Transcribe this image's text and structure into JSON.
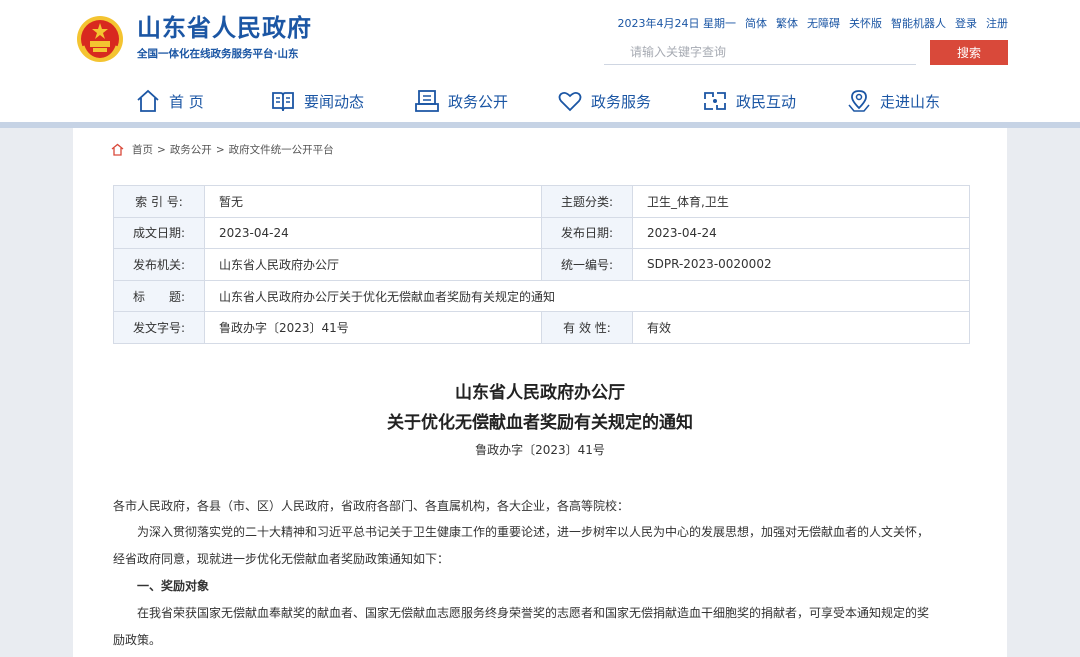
{
  "header": {
    "site_name": "山东省人民政府",
    "site_sub": "全国一体化在线政务服务平台·山东",
    "date": "2023年4月24日 星期一",
    "links": [
      "简体",
      "繁体",
      "无障碍",
      "关怀版",
      "智能机器人",
      "登录",
      "注册"
    ],
    "search_placeholder": "请输入关键字查询",
    "search_button": "搜索"
  },
  "nav": [
    {
      "label": "首 页",
      "icon": "home-icon"
    },
    {
      "label": "要闻动态",
      "icon": "news-book-icon"
    },
    {
      "label": "政务公开",
      "icon": "document-icon"
    },
    {
      "label": "政务服务",
      "icon": "heart-icon"
    },
    {
      "label": "政民互动",
      "icon": "interaction-icon"
    },
    {
      "label": "走进山东",
      "icon": "map-pin-icon"
    }
  ],
  "breadcrumb": [
    "首页",
    "政务公开",
    "政府文件统一公开平台"
  ],
  "meta": {
    "index_label": "索 引 号:",
    "index_value": "暂无",
    "topic_label": "主题分类:",
    "topic_value": "卫生_体育,卫生",
    "written_label": "成文日期:",
    "written_value": "2023-04-24",
    "published_label": "发布日期:",
    "published_value": "2023-04-24",
    "issuer_label": "发布机关:",
    "issuer_value": "山东省人民政府办公厅",
    "code_label": "统一编号:",
    "code_value": "SDPR-2023-0020002",
    "title_label": "标　　题:",
    "title_value": "山东省人民政府办公厅关于优化无偿献血者奖励有关规定的通知",
    "docno_label": "发文字号:",
    "docno_value": "鲁政办字〔2023〕41号",
    "validity_label": "有 效 性:",
    "validity_value": "有效"
  },
  "document": {
    "title_line1": "山东省人民政府办公厅",
    "title_line2": "关于优化无偿献血者奖励有关规定的通知",
    "number": "鲁政办字〔2023〕41号",
    "addressee": "各市人民政府，各县（市、区）人民政府，省政府各部门、各直属机构，各大企业，各高等院校：",
    "para1_line1": "为深入贯彻落实党的二十大精神和习近平总书记关于卫生健康工作的重要论述，进一步树牢以人民为中心的发展思想，加强对无偿献血者的人文关怀，",
    "para1_line2": "经省政府同意，现就进一步优化无偿献血者奖励政策通知如下：",
    "section1_heading": "一、奖励对象",
    "para2_line1": "在我省荣获国家无偿献血奉献奖的献血者、国家无偿献血志愿服务终身荣誉奖的志愿者和国家无偿捐献造血干细胞奖的捐献者，可享受本通知规定的奖",
    "para2_line2": "励政策。"
  },
  "colors": {
    "brand_blue": "#1b56a4",
    "accent_red": "#d9493a",
    "band": "#c6d3e5"
  }
}
